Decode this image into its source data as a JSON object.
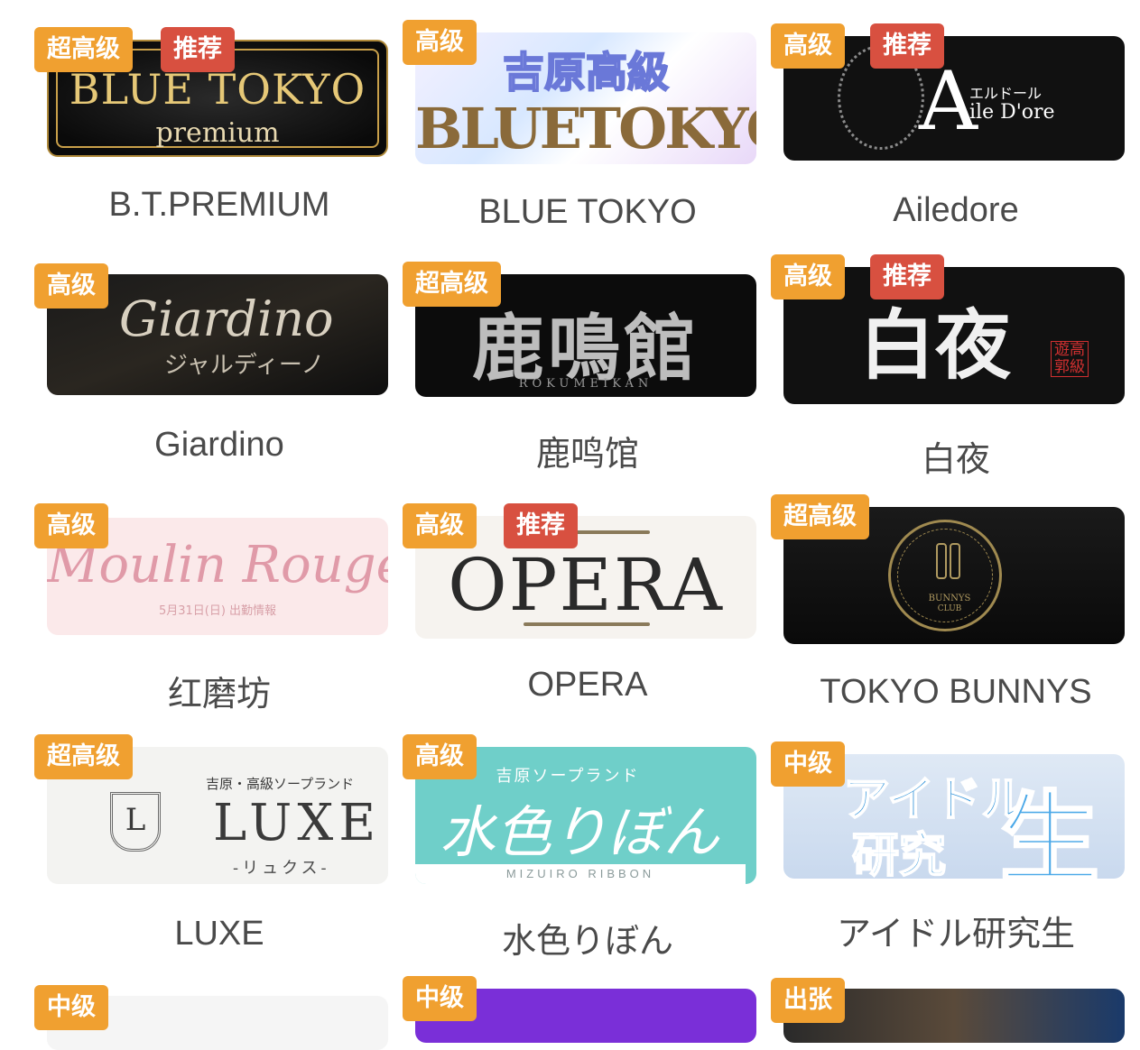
{
  "colors": {
    "tier_badge": "#f0a030",
    "recommend_badge": "#d85040",
    "name_text": "#4a4a4a"
  },
  "cards": [
    {
      "name": "B.T.PREMIUM",
      "tier": "超高级",
      "recommend": "推荐",
      "logo": {
        "line1": "BLUE TOKYO",
        "line2": "premium"
      }
    },
    {
      "name": "BLUE TOKYO",
      "tier": "高级",
      "recommend": null,
      "logo": {
        "line1": "吉原高級",
        "line2": "BLUETOKYO"
      }
    },
    {
      "name": "Ailedore",
      "tier": "高级",
      "recommend": "推荐",
      "logo": {
        "line1": "エルドール",
        "line2": "ile D'ore",
        "initial": "A"
      }
    },
    {
      "name": "Giardino",
      "tier": "高级",
      "recommend": null,
      "logo": {
        "line1": "Giardino",
        "line2": "ジャルディーノ"
      }
    },
    {
      "name": "鹿鸣馆",
      "tier": "超高级",
      "recommend": null,
      "logo": {
        "line1": "鹿鳴館",
        "line2": "ROKUMEIKAN"
      }
    },
    {
      "name": "白夜",
      "tier": "高级",
      "recommend": "推荐",
      "logo": {
        "line1": "白夜",
        "stamp": "遊高郭級"
      }
    },
    {
      "name": "红磨坊",
      "tier": "高级",
      "recommend": null,
      "logo": {
        "line1": "Moulin Rouge",
        "line2": "5月31日(日) 出勤情報"
      }
    },
    {
      "name": "OPERA",
      "tier": "高级",
      "recommend": "推荐",
      "logo": {
        "line1": "OPERA"
      }
    },
    {
      "name": "TOKYO BUNNYS",
      "tier": "超高级",
      "recommend": null,
      "logo": {
        "line1": "BUNNYS",
        "line2": "CLUB"
      }
    },
    {
      "name": "LUXE",
      "tier": "超高级",
      "recommend": null,
      "logo": {
        "line1": "吉原・高級ソープランド",
        "line2": "LUXE",
        "line3": "-リュクス-",
        "initial": "L"
      }
    },
    {
      "name": "水色りぼん",
      "tier": "高级",
      "recommend": null,
      "logo": {
        "line1": "吉原ソープランド",
        "line2": "水色りぼん",
        "line3": "MIZUIRO RIBBON"
      }
    },
    {
      "name": "アイドル研究生",
      "tier": "中级",
      "recommend": null,
      "logo": {
        "line1": "アイドル",
        "line2": "研究",
        "line3": "生"
      }
    },
    {
      "name": "",
      "tier": "中级",
      "recommend": null,
      "logo": {}
    },
    {
      "name": "",
      "tier": "中级",
      "recommend": null,
      "logo": {}
    },
    {
      "name": "",
      "tier": "出张",
      "recommend": null,
      "logo": {}
    }
  ]
}
